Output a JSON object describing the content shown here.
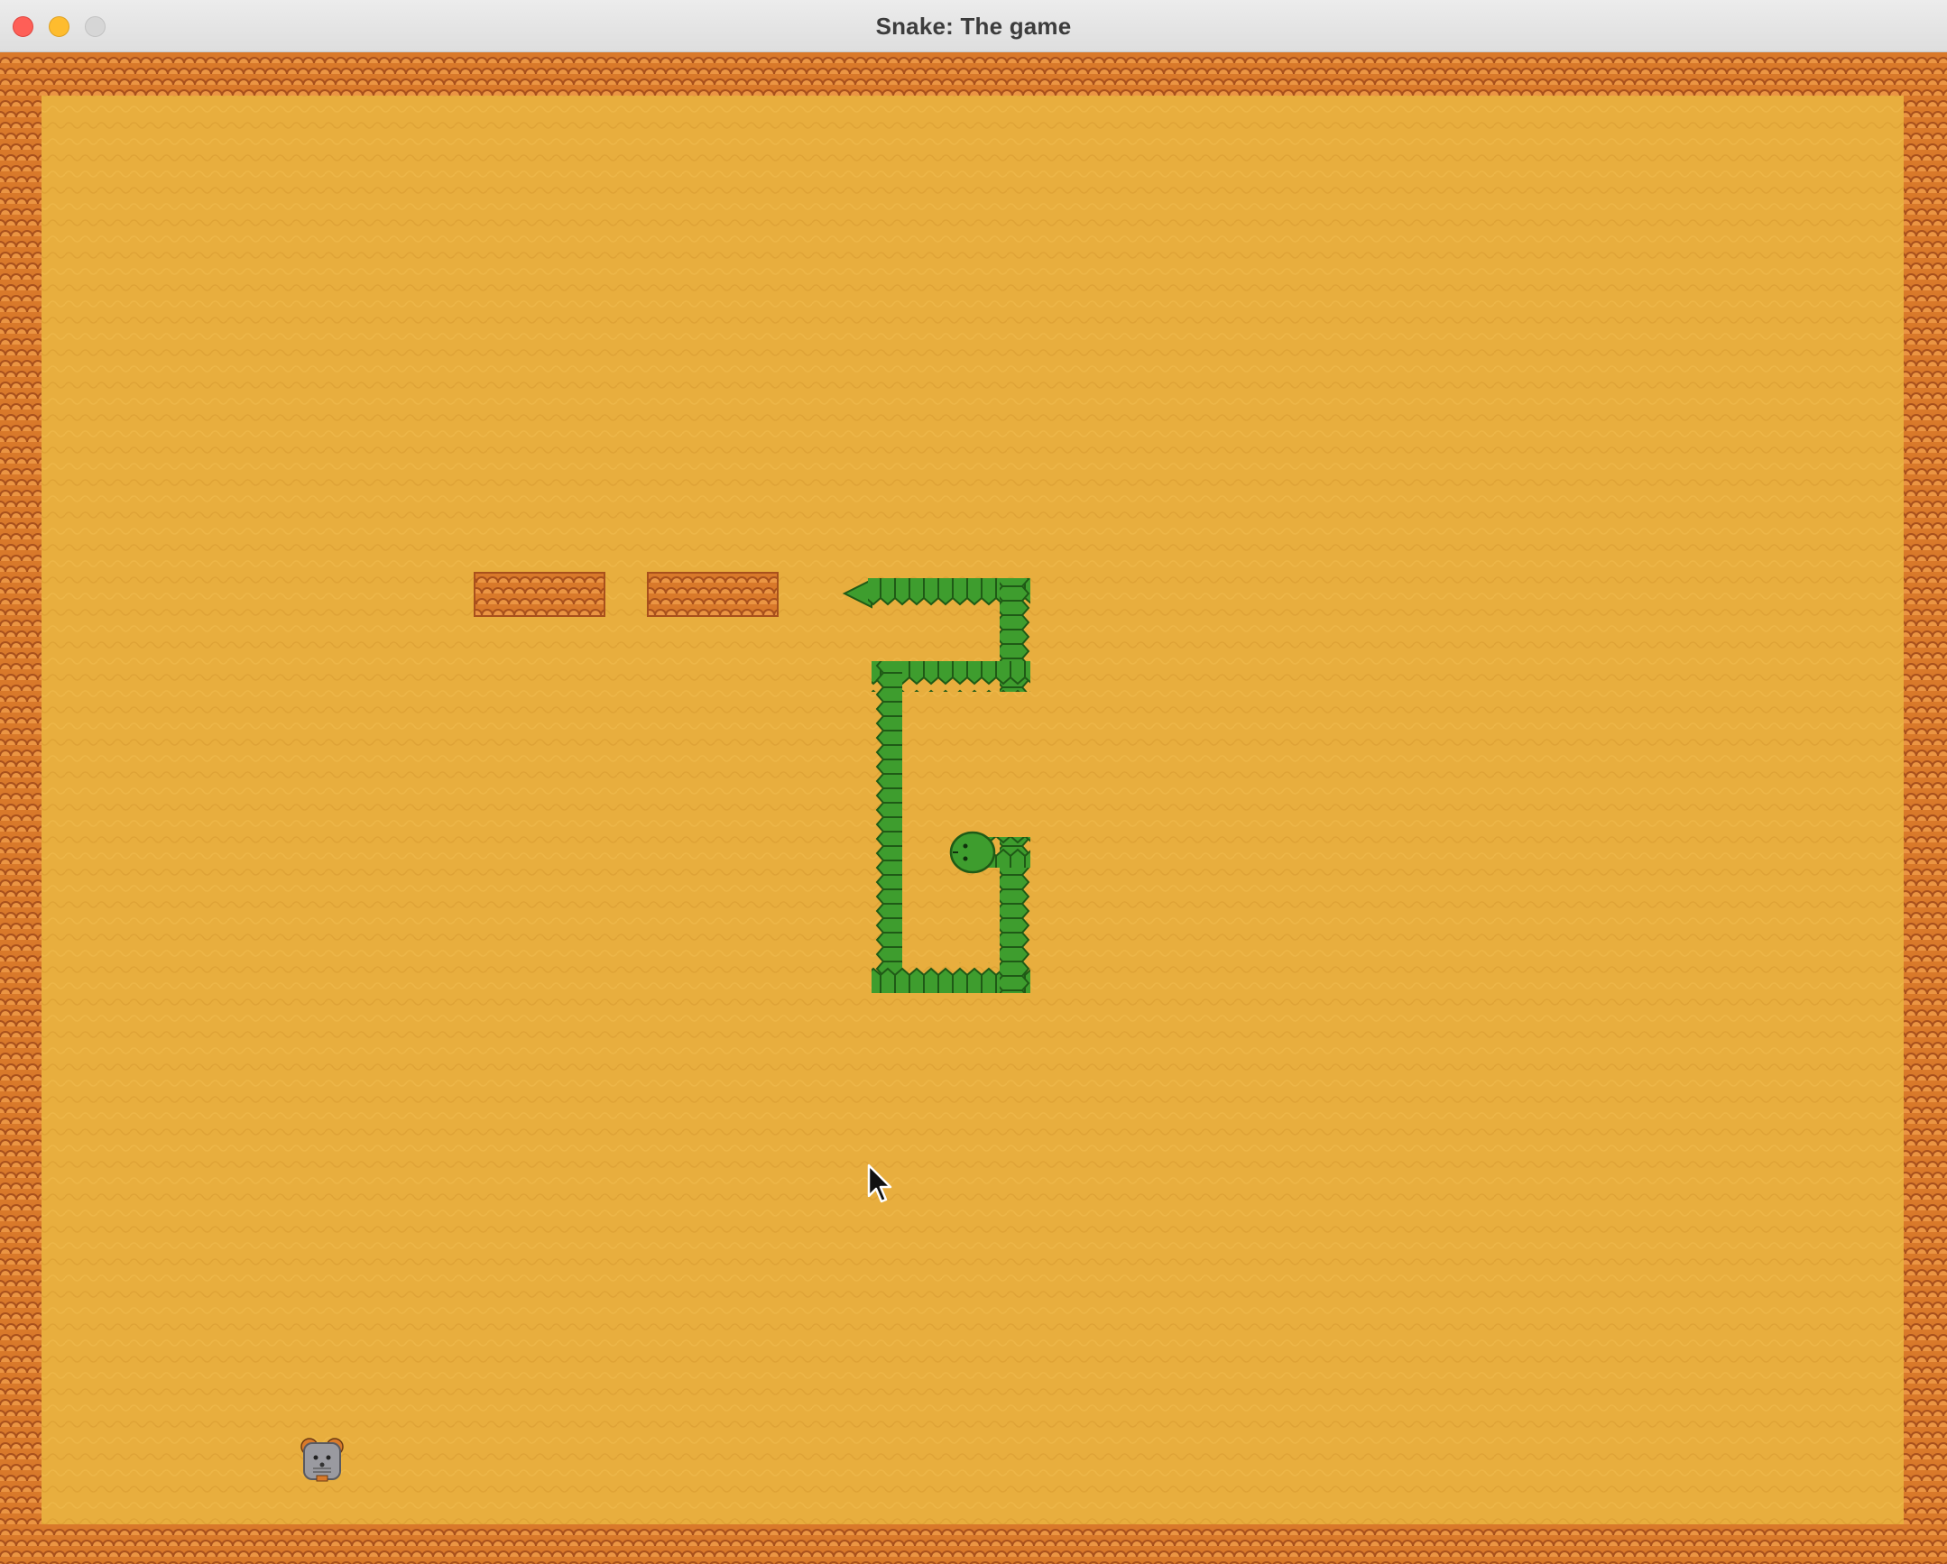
{
  "window": {
    "title": "Snake: The game"
  },
  "colors": {
    "sand": "#e8ae3e",
    "wall": "#d9792a",
    "wall_dark": "#a8501c",
    "snake": "#3e9d2e",
    "snake_dark": "#1f5a16",
    "mouse": "#9a9aa0",
    "mouse_ears": "#d97a2a"
  },
  "icons": {
    "close": "close-icon",
    "minimize": "minimize-icon",
    "maximize": "maximize-icon",
    "food": "mouse-icon",
    "cursor": "cursor-icon"
  }
}
